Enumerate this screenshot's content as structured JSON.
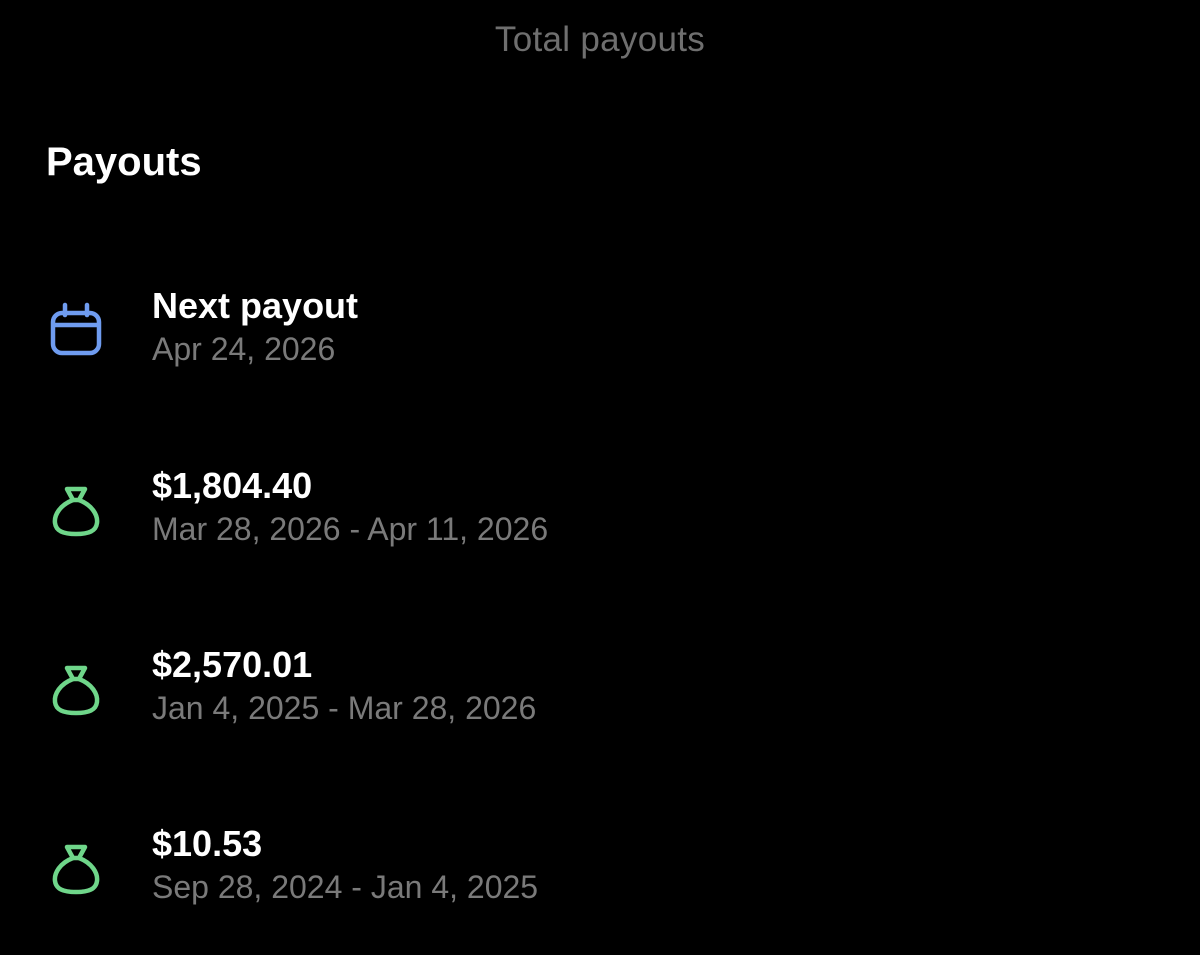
{
  "header": {
    "tab_label": "Total payouts"
  },
  "section": {
    "title": "Payouts"
  },
  "next_payout": {
    "label": "Next payout",
    "date": "Apr 24, 2026",
    "icon": "calendar-icon",
    "icon_color": "#6f9cf0"
  },
  "payouts": [
    {
      "amount": "$1,804.40",
      "period": "Mar 28, 2026 - Apr 11, 2026",
      "icon": "money-bag-icon"
    },
    {
      "amount": "$2,570.01",
      "period": "Jan 4, 2025 - Mar 28, 2026",
      "icon": "money-bag-icon"
    },
    {
      "amount": "$10.53",
      "period": "Sep 28, 2024 - Jan 4, 2025",
      "icon": "money-bag-icon"
    }
  ],
  "colors": {
    "background": "#000000",
    "money_icon": "#6fd68a",
    "secondary_text": "#7a7a7a"
  }
}
